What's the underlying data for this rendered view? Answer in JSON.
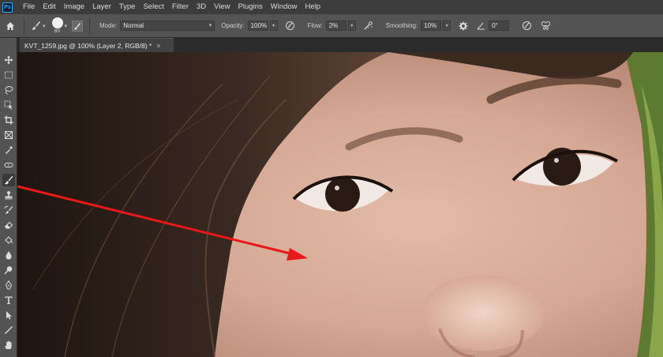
{
  "app": {
    "logo_text": "Ps",
    "accent_color": "#31a8ff"
  },
  "menu": [
    "File",
    "Edit",
    "Image",
    "Layer",
    "Type",
    "Select",
    "Filter",
    "3D",
    "View",
    "Plugins",
    "Window",
    "Help"
  ],
  "options_bar": {
    "brush_size": "80",
    "mode_label": "Mode:",
    "mode_value": "Normal",
    "opacity_label": "Opacity:",
    "opacity_value": "100%",
    "flow_label": "Flow:",
    "flow_value": "2%",
    "smoothing_label": "Smoothing:",
    "smoothing_value": "10%",
    "angle_value": "0°"
  },
  "document": {
    "tab_title": "KVT_1259.jpg @ 100% (Layer 2, RGB/8) *",
    "close_glyph": "×"
  },
  "annotation": {
    "arrow_color": "#e8191b"
  },
  "icons": {
    "home": "home-icon",
    "brush": "brush-icon",
    "airbrush": "airbrush-icon",
    "settings": "gear-icon",
    "pressure": "pressure-icon",
    "symmetry": "butterfly-icon"
  }
}
